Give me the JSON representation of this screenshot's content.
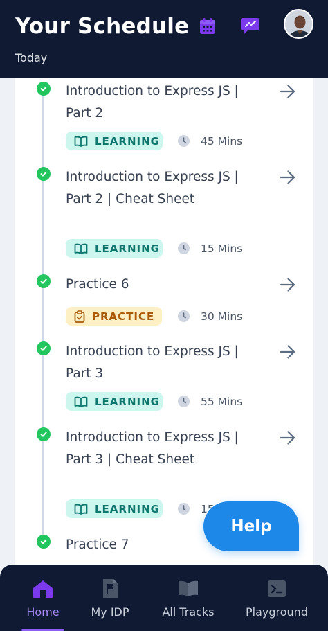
{
  "header": {
    "title": "Your Schedule",
    "subtitle": "Today",
    "icons": [
      "calendar-icon",
      "chat-icon"
    ],
    "accent_color": "#7c3aed"
  },
  "schedule": {
    "items": [
      {
        "title": "Introduction to Express JS | Part 2",
        "type": "LEARNING",
        "duration": "45 Mins",
        "completed": true
      },
      {
        "title": "Introduction to Express JS | Part 2 | Cheat Sheet",
        "type": "LEARNING",
        "duration": "15 Mins",
        "completed": true
      },
      {
        "title": "Practice 6",
        "type": "PRACTICE",
        "duration": "30 Mins",
        "completed": true
      },
      {
        "title": "Introduction to Express JS | Part 3",
        "type": "LEARNING",
        "duration": "55 Mins",
        "completed": true
      },
      {
        "title": "Introduction to Express JS | Part 3 | Cheat Sheet",
        "type": "LEARNING",
        "duration": "15",
        "completed": true
      },
      {
        "title": "Practice 7",
        "completed": true
      }
    ]
  },
  "help_button": {
    "label": "Help"
  },
  "bottom_nav": {
    "items": [
      {
        "label": "Home",
        "icon": "home-icon",
        "active": true
      },
      {
        "label": "My IDP",
        "icon": "document-flag-icon",
        "active": false
      },
      {
        "label": "All Tracks",
        "icon": "open-book-icon",
        "active": false
      },
      {
        "label": "Playground",
        "icon": "terminal-icon",
        "active": false
      }
    ]
  },
  "colors": {
    "header_bg": "#101a33",
    "check_green": "#22c55e",
    "learning_bg": "#cdf7ee",
    "learning_text": "#0f766e",
    "practice_bg": "#fdf0c4",
    "practice_text": "#a85a06",
    "help_blue": "#1e88e8"
  }
}
